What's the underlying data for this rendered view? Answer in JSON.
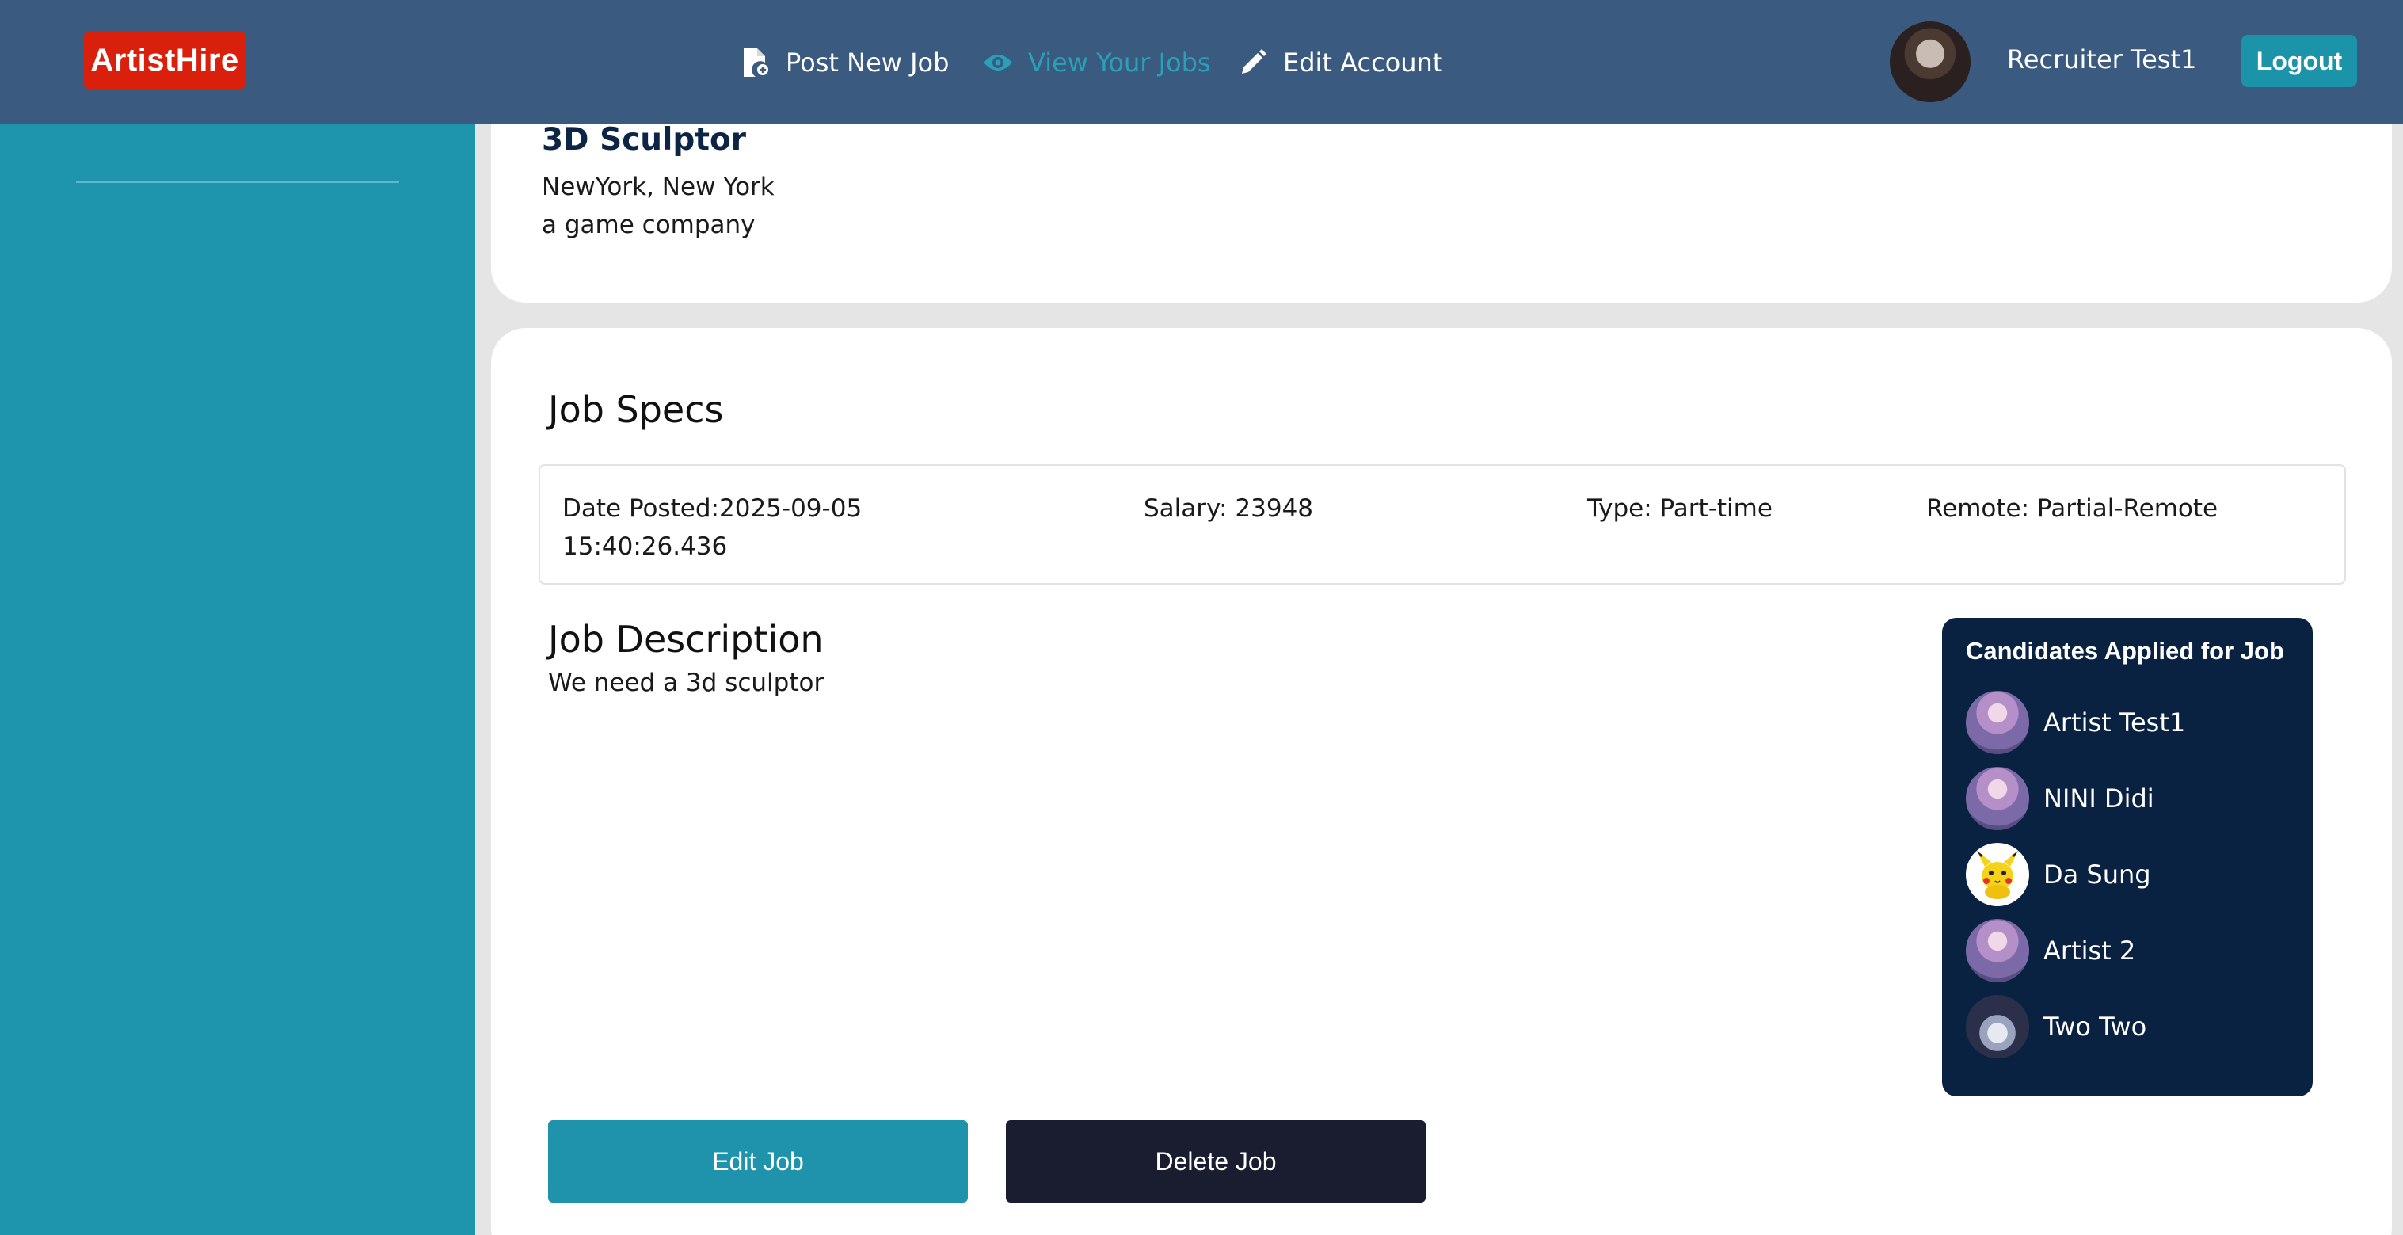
{
  "navbar": {
    "logo": "ArtistHire",
    "items": [
      {
        "label": "Post New Job",
        "icon": "file-plus-icon"
      },
      {
        "label": "View Your Jobs",
        "icon": "eye-icon",
        "active": true
      },
      {
        "label": "Edit Account",
        "icon": "pencil-icon"
      }
    ],
    "user_name": "Recruiter Test1",
    "logout_label": "Logout"
  },
  "job": {
    "title": "3D Sculptor",
    "location": "NewYork, New York",
    "company": "a game company"
  },
  "specs": {
    "heading": "Job Specs",
    "date_posted": "Date Posted:2025-09-05 15:40:26.436",
    "salary": "Salary: 23948",
    "type": "Type: Part-time",
    "remote": "Remote: Partial-Remote"
  },
  "description": {
    "heading": "Job Description",
    "text": "We need a 3d sculptor"
  },
  "candidates": {
    "heading": "Candidates Applied for Job",
    "list": [
      {
        "name": "Artist Test1"
      },
      {
        "name": "NINI Didi"
      },
      {
        "name": "Da Sung"
      },
      {
        "name": "Artist 2"
      },
      {
        "name": "Two Two"
      }
    ]
  },
  "actions": {
    "edit_label": "Edit Job",
    "delete_label": "Delete Job"
  },
  "colors": {
    "navbar": "#3a5b7f",
    "logo": "#d8200c",
    "accent": "#1f95ad",
    "candidates_panel": "#0a2242",
    "delete_button": "#1a1c30"
  }
}
